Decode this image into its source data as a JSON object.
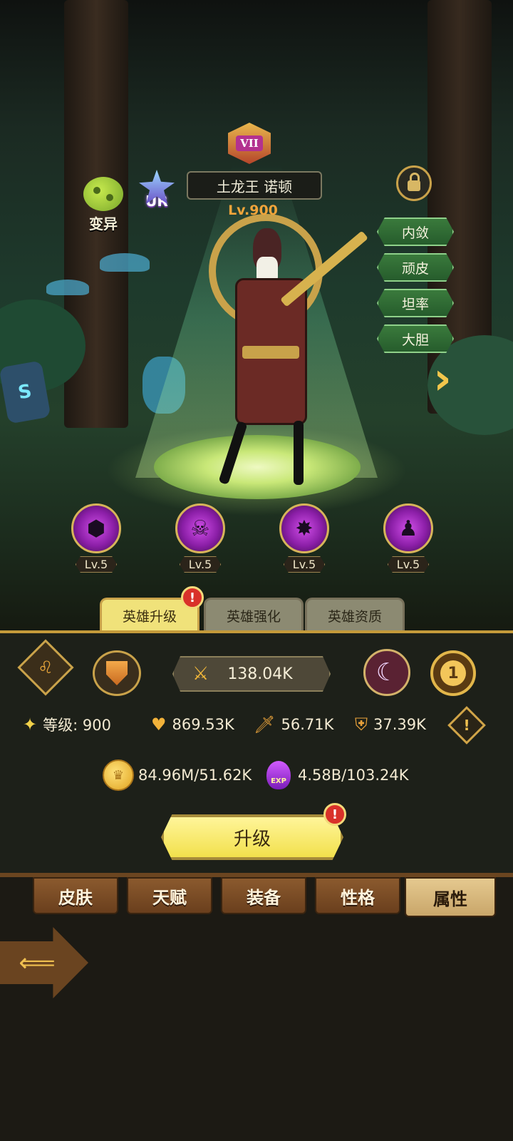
{
  "hero": {
    "name": "土龙王 诺顿",
    "level_label": "Lv.900",
    "rank_numeral": "VII",
    "rarity": "UR",
    "mutation_label": "变异"
  },
  "scene": {
    "rune_glyph": "S"
  },
  "traits": [
    "内敛",
    "顽皮",
    "坦率",
    "大胆"
  ],
  "skills": [
    {
      "icon": "shield-skill-icon",
      "level": "Lv.5"
    },
    {
      "icon": "spirit-skill-icon",
      "level": "Lv.5"
    },
    {
      "icon": "spike-burst-skill-icon",
      "level": "Lv.5"
    },
    {
      "icon": "shadow-figure-skill-icon",
      "level": "Lv.5"
    }
  ],
  "hero_tabs": [
    "英雄升级",
    "英雄强化",
    "英雄资质"
  ],
  "alerts": {
    "tab_alert": "!",
    "upgrade_alert": "!"
  },
  "power": {
    "value": "138.04K"
  },
  "emblem_number": "1",
  "stats": {
    "level_label": "等级: 900",
    "hp": "869.53K",
    "attack": "56.71K",
    "defense": "37.39K",
    "info": "!"
  },
  "resources": {
    "gold": "84.96M/51.62K",
    "exp": "4.58B/103.24K",
    "exp_label": "EXP"
  },
  "upgrade_button": "升级",
  "bottom_nav": [
    "皮肤",
    "天赋",
    "装备",
    "性格",
    "属性"
  ],
  "colors": {
    "accent_gold": "#c9a24a",
    "tab_active": "#f0e27a",
    "upgrade_yellow": "#f2e04c",
    "trait_green": "#3a7a3c",
    "alert_red": "#d9312a"
  }
}
